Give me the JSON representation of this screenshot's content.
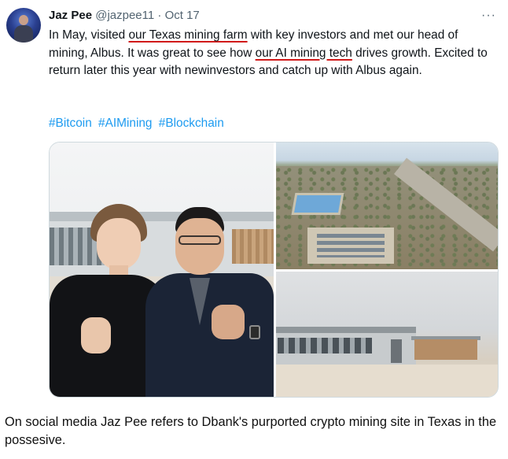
{
  "tweet": {
    "author": {
      "name": "Jaz Pee",
      "handle": "@jazpee11",
      "separator": "·",
      "date": "Oct 17"
    },
    "more_icon": "more-horizontal-icon",
    "more_glyph": "···",
    "text": {
      "part1": "In May, visited ",
      "highlight1": "our Texas mining farm",
      "part2": " with key investors and met our head of mining, Albus. It was great to see how ",
      "highlight2": "our AI mining tech",
      "part3": " drives growth. Excited to return later this year with newinvestors and catch up with Albus again."
    },
    "hashtags": [
      "#Bitcoin",
      "#AIMining",
      "#Blockchain"
    ],
    "underline_color": "#d11a1a",
    "hashtag_color": "#1d9bf0"
  },
  "caption": "On social media Jaz Pee refers to Dbank's purported crypto mining site in Texas in the possesive."
}
